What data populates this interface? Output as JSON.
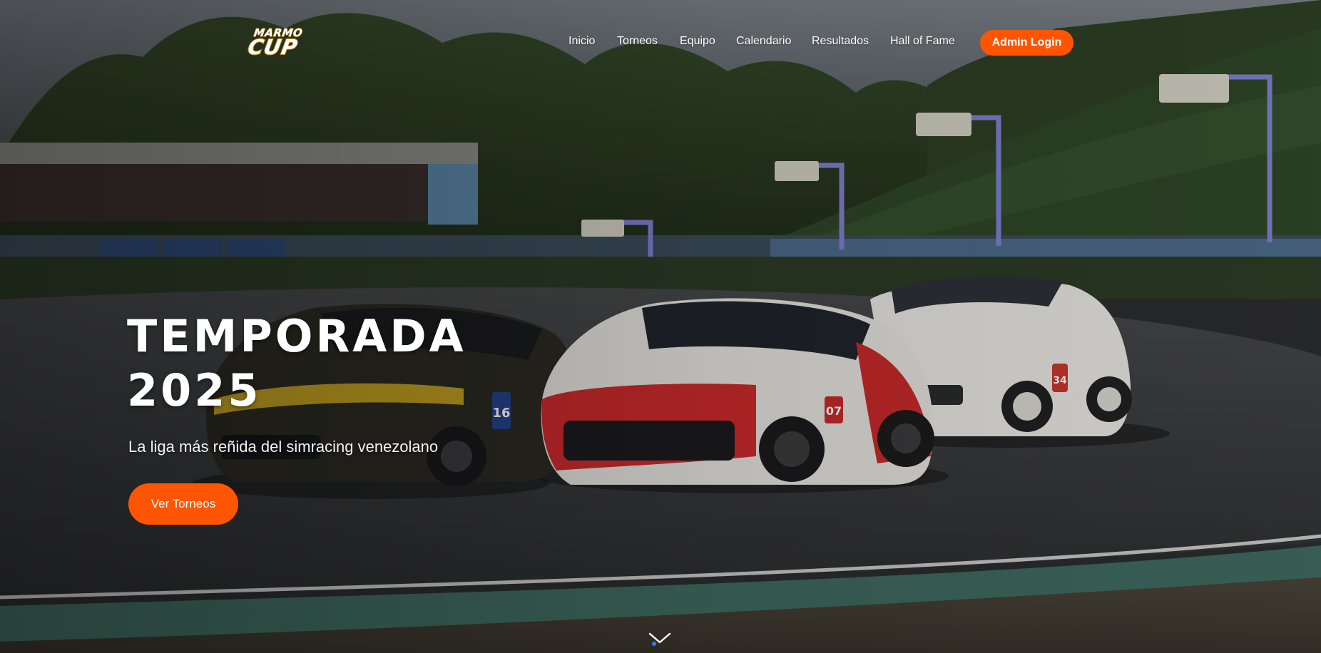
{
  "brand": {
    "logo_top": "MARMO",
    "logo_bottom": "CUP"
  },
  "nav": {
    "items": [
      {
        "label": "Inicio"
      },
      {
        "label": "Torneos"
      },
      {
        "label": "Equipo"
      },
      {
        "label": "Calendario"
      },
      {
        "label": "Resultados"
      },
      {
        "label": "Hall of Fame"
      }
    ],
    "admin_label": "Admin Login"
  },
  "hero": {
    "title_line1": "TEMPORADA",
    "title_line2": "2025",
    "subtitle": "La liga más reñida del simracing venezolano",
    "cta_label": "Ver Torneos",
    "car_numbers": [
      "16",
      "07",
      "34"
    ]
  },
  "icons": {
    "scroll": "chevron-down-icon"
  },
  "colors": {
    "accent": "#ff5500",
    "logo_gold": "#c7861e"
  }
}
